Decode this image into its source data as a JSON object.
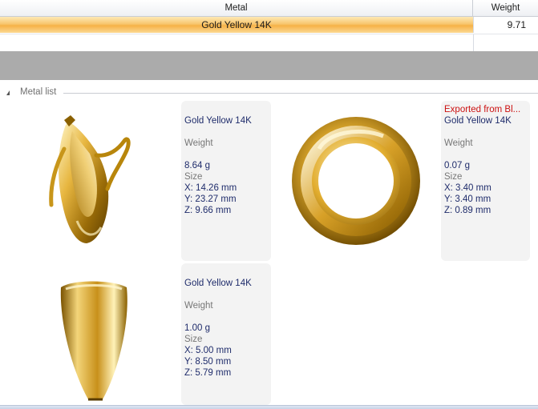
{
  "table": {
    "headers": {
      "metal": "Metal",
      "weight": "Weight"
    },
    "rows": [
      {
        "metal": "Gold Yellow 14K",
        "weight": "9.71"
      }
    ]
  },
  "group": {
    "title": "Metal list"
  },
  "items": [
    {
      "exported": "",
      "metal": "Gold Yellow 14K",
      "weight_label": "Weight",
      "weight": "8.64 g",
      "size_label": "Size",
      "x": "X: 14.26 mm",
      "y": "Y: 23.27 mm",
      "z": "Z: 9.66 mm",
      "thumbnail": "banana-pendant"
    },
    {
      "exported": "Exported from Bl...",
      "metal": "Gold Yellow 14K",
      "weight_label": "Weight",
      "weight": "0.07 g",
      "size_label": "Size",
      "x": "X: 3.40 mm",
      "y": "Y: 3.40 mm",
      "z": "Z: 0.89 mm",
      "thumbnail": "gold-ring"
    },
    {
      "exported": "",
      "metal": "Gold Yellow 14K",
      "weight_label": "Weight",
      "weight": "1.00 g",
      "size_label": "Size",
      "x": "X: 5.00 mm",
      "y": "Y: 8.50 mm",
      "z": "Z: 5.79 mm",
      "thumbnail": "bail"
    }
  ],
  "colors": {
    "gold_light": "#fff6c8",
    "gold_mid": "#d9a52b",
    "gold_dark": "#7a5200",
    "row_highlight": "#f6b246"
  }
}
